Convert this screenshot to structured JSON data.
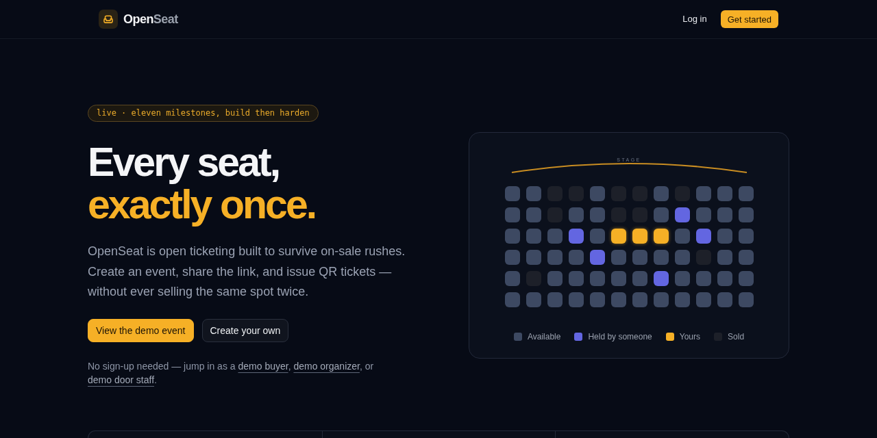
{
  "header": {
    "wordmark": [
      {
        "text": "Open",
        "muted": false
      },
      {
        "text": "Seat",
        "muted": true
      }
    ],
    "nav": [
      {
        "kind": "link",
        "label": "Log in"
      },
      {
        "kind": "button",
        "label": "Get started"
      }
    ]
  },
  "hero": {
    "badge": "live · eleven milestones, build then harden",
    "headline": [
      {
        "text": "Every seat,",
        "accent": false
      },
      {
        "text": "exactly once.",
        "accent": true
      }
    ],
    "description": "OpenSeat is open ticketing built to survive on-sale rushes. Create an event, share the link, and issue QR tickets — without ever selling the same spot twice.",
    "buttons": [
      {
        "kind": "primary",
        "label": "View the demo event"
      },
      {
        "kind": "secondary",
        "label": "Create your own"
      }
    ],
    "note": [
      {
        "kind": "text",
        "text": "No sign-up needed — jump in as a "
      },
      {
        "kind": "link",
        "text": "demo buyer"
      },
      {
        "kind": "text",
        "text": ", "
      },
      {
        "kind": "link",
        "text": "demo organizer"
      },
      {
        "kind": "text",
        "text": ", or "
      },
      {
        "kind": "link",
        "text": "demo door staff"
      },
      {
        "kind": "text",
        "text": "."
      }
    ]
  },
  "seat_map": {
    "stage_label": "STAGE",
    "rows": [
      [
        {
          "kind": "available"
        },
        {
          "kind": "available"
        },
        {
          "kind": "sold"
        },
        {
          "kind": "sold"
        },
        {
          "kind": "available"
        },
        {
          "kind": "sold"
        },
        {
          "kind": "sold"
        },
        {
          "kind": "available"
        },
        {
          "kind": "sold"
        },
        {
          "kind": "available"
        },
        {
          "kind": "available"
        },
        {
          "kind": "available"
        }
      ],
      [
        {
          "kind": "available"
        },
        {
          "kind": "available"
        },
        {
          "kind": "sold"
        },
        {
          "kind": "available"
        },
        {
          "kind": "available"
        },
        {
          "kind": "sold"
        },
        {
          "kind": "sold"
        },
        {
          "kind": "available"
        },
        {
          "kind": "held"
        },
        {
          "kind": "available"
        },
        {
          "kind": "available"
        },
        {
          "kind": "available"
        }
      ],
      [
        {
          "kind": "available"
        },
        {
          "kind": "available"
        },
        {
          "kind": "available"
        },
        {
          "kind": "held"
        },
        {
          "kind": "available"
        },
        {
          "kind": "yours"
        },
        {
          "kind": "yours"
        },
        {
          "kind": "yours"
        },
        {
          "kind": "available"
        },
        {
          "kind": "held"
        },
        {
          "kind": "available"
        },
        {
          "kind": "available"
        }
      ],
      [
        {
          "kind": "available"
        },
        {
          "kind": "available"
        },
        {
          "kind": "available"
        },
        {
          "kind": "available"
        },
        {
          "kind": "held"
        },
        {
          "kind": "available"
        },
        {
          "kind": "available"
        },
        {
          "kind": "available"
        },
        {
          "kind": "available"
        },
        {
          "kind": "sold"
        },
        {
          "kind": "available"
        },
        {
          "kind": "available"
        }
      ],
      [
        {
          "kind": "available"
        },
        {
          "kind": "sold"
        },
        {
          "kind": "available"
        },
        {
          "kind": "available"
        },
        {
          "kind": "available"
        },
        {
          "kind": "available"
        },
        {
          "kind": "available"
        },
        {
          "kind": "held"
        },
        {
          "kind": "available"
        },
        {
          "kind": "available"
        },
        {
          "kind": "available"
        },
        {
          "kind": "available"
        }
      ],
      [
        {
          "kind": "available"
        },
        {
          "kind": "available"
        },
        {
          "kind": "available"
        },
        {
          "kind": "available"
        },
        {
          "kind": "available"
        },
        {
          "kind": "available"
        },
        {
          "kind": "available"
        },
        {
          "kind": "available"
        },
        {
          "kind": "available"
        },
        {
          "kind": "available"
        },
        {
          "kind": "available"
        },
        {
          "kind": "available"
        }
      ]
    ],
    "legend": [
      {
        "label": "Available",
        "kind": "available",
        "color": "#3d4962"
      },
      {
        "label": "Held by someone",
        "kind": "held",
        "color": "#6366e1"
      },
      {
        "label": "Yours",
        "kind": "yours",
        "color": "#f6b026"
      },
      {
        "label": "Sold",
        "kind": "sold",
        "color": "#1d2029"
      }
    ]
  }
}
